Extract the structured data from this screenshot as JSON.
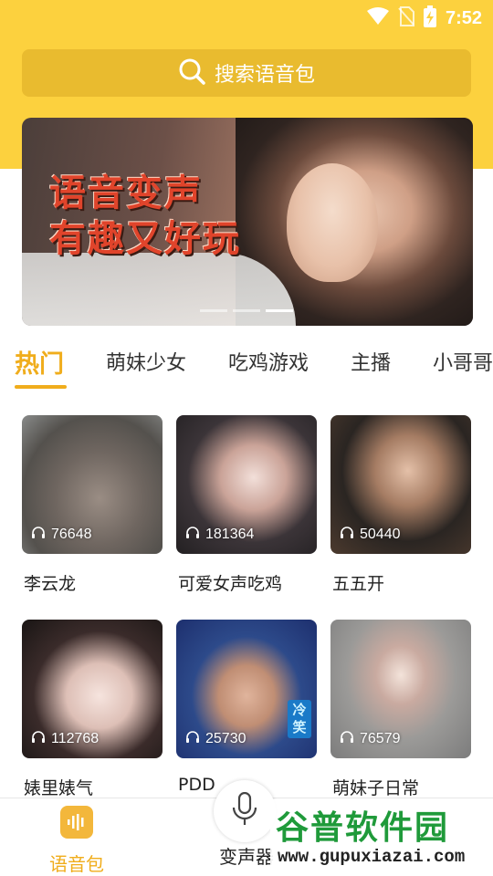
{
  "status_bar": {
    "time": "7:52",
    "icons": [
      "wifi-icon",
      "no-sim-icon",
      "battery-charging-icon"
    ]
  },
  "search": {
    "placeholder": "搜索语音包",
    "icon": "search-icon"
  },
  "banner": {
    "title_line1": "语音变声",
    "title_line2": "有趣又好玩",
    "page_count": 3,
    "active_page": 3
  },
  "tabs": [
    {
      "label": "热门",
      "active": true
    },
    {
      "label": "萌妹少女",
      "active": false
    },
    {
      "label": "吃鸡游戏",
      "active": false
    },
    {
      "label": "主播",
      "active": false
    },
    {
      "label": "小哥哥",
      "active": false
    }
  ],
  "cards": [
    {
      "title": "李云龙",
      "plays": "76648"
    },
    {
      "title": "可爱女声吃鸡",
      "plays": "181364"
    },
    {
      "title": "五五开",
      "plays": "50440"
    },
    {
      "title": "婊里婊气",
      "plays": "112768"
    },
    {
      "title": "PDD",
      "plays": "25730",
      "badge": "冷笑"
    },
    {
      "title": "萌妹子日常",
      "plays": "76579"
    }
  ],
  "bottom_nav": {
    "voice_pack_label": "语音包",
    "voice_changer_label": "变声器"
  },
  "watermark": {
    "title": "谷普软件园",
    "url": "www.gupuxiazai.com"
  },
  "colors": {
    "brand_yellow": "#fcd13e",
    "accent_orange": "#f0ad1c",
    "watermark_green": "#1f9a3a"
  }
}
